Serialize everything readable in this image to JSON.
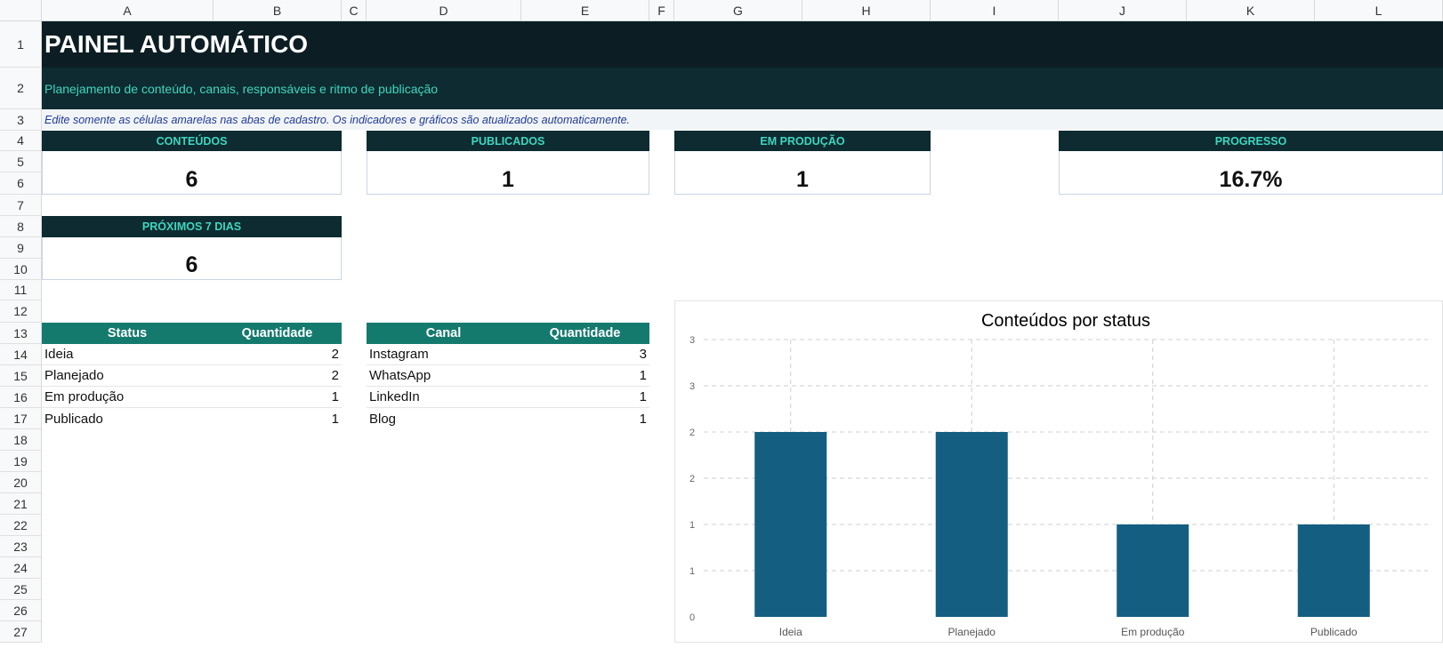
{
  "columns": [
    "A",
    "B",
    "C",
    "D",
    "E",
    "F",
    "G",
    "H",
    "I",
    "J",
    "K",
    "L"
  ],
  "rows": [
    "1",
    "2",
    "3",
    "4",
    "5",
    "6",
    "7",
    "8",
    "9",
    "10",
    "11",
    "12",
    "13",
    "14",
    "15",
    "16",
    "17",
    "18",
    "19",
    "20",
    "21",
    "22",
    "23",
    "24",
    "25",
    "26",
    "27"
  ],
  "dashboard": {
    "title": "PAINEL AUTOMÁTICO",
    "subtitle": "Planejamento de conteúdo, canais, responsáveis e ritmo de publicação",
    "note": "Edite somente as células amarelas nas abas de cadastro. Os indicadores e gráficos são atualizados automaticamente."
  },
  "kpis": {
    "conteudos": {
      "label": "CONTEÚDOS",
      "value": "6"
    },
    "publicados": {
      "label": "PUBLICADOS",
      "value": "1"
    },
    "em_producao": {
      "label": "EM PRODUÇÃO",
      "value": "1"
    },
    "progresso": {
      "label": "PROGRESSO",
      "value": "16.7%"
    },
    "proximos": {
      "label": "PRÓXIMOS 7 DIAS",
      "value": "6"
    }
  },
  "status_table": {
    "headers": [
      "Status",
      "Quantidade"
    ],
    "rows": [
      [
        "Ideia",
        "2"
      ],
      [
        "Planejado",
        "2"
      ],
      [
        "Em produção",
        "1"
      ],
      [
        "Publicado",
        "1"
      ]
    ]
  },
  "channel_table": {
    "headers": [
      "Canal",
      "Quantidade"
    ],
    "rows": [
      [
        "Instagram",
        "3"
      ],
      [
        "WhatsApp",
        "1"
      ],
      [
        "LinkedIn",
        "1"
      ],
      [
        "Blog",
        "1"
      ]
    ]
  },
  "colors": {
    "bar": "#145e82",
    "title_bg": "#0c1e24",
    "accent": "#3fd6bf",
    "table_header": "#157a6e"
  },
  "chart_data": {
    "type": "bar",
    "title": "Conteúdos por status",
    "categories": [
      "Ideia",
      "Planejado",
      "Em produção",
      "Publicado"
    ],
    "values": [
      2,
      2,
      1,
      1
    ],
    "ylim": [
      0,
      3
    ],
    "ytick_labels": [
      "0",
      "1",
      "1",
      "2",
      "2",
      "3",
      "3"
    ],
    "grid": true,
    "xlabel": "",
    "ylabel": ""
  }
}
